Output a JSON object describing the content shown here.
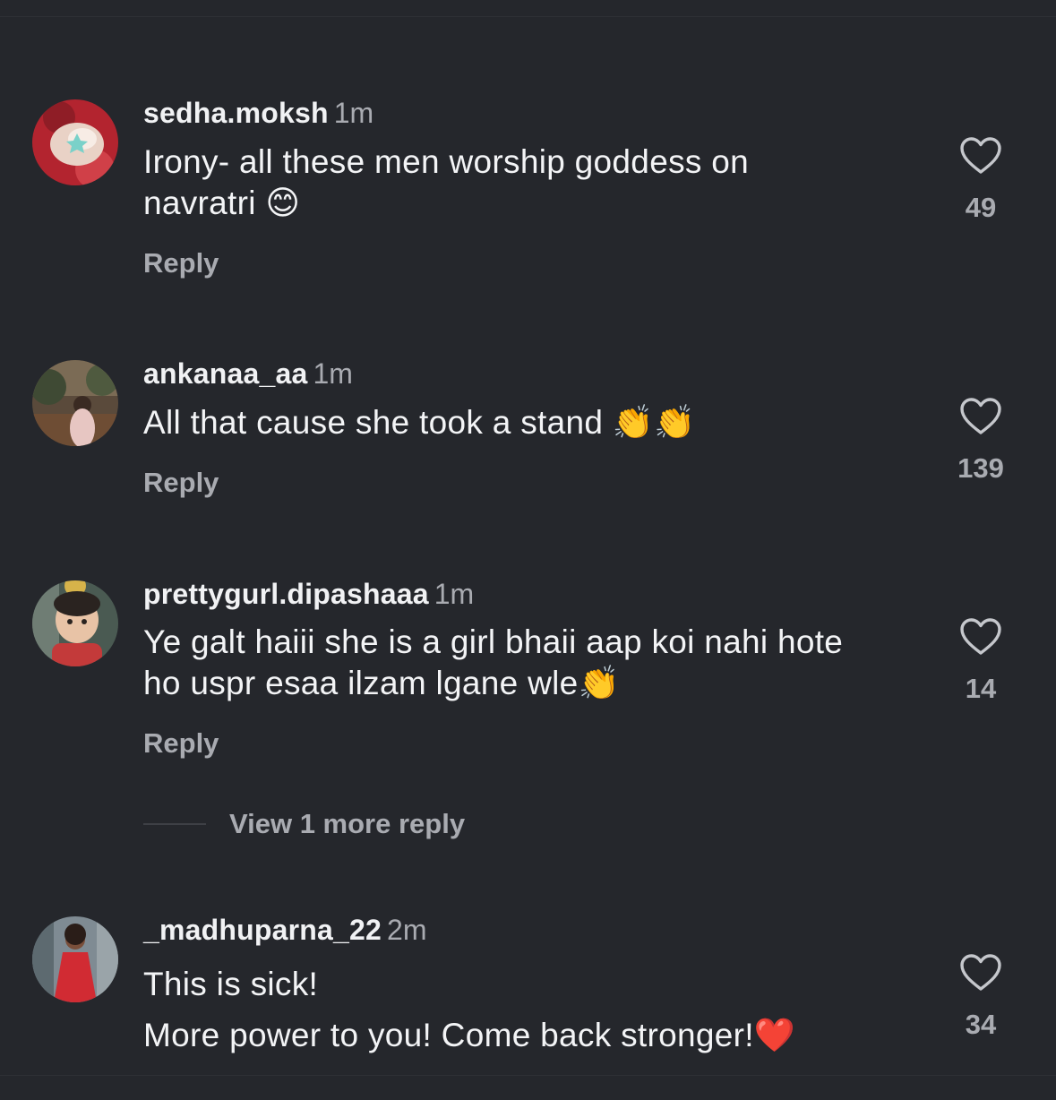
{
  "comments": [
    {
      "username": "sedha.moksh",
      "time": "1m",
      "lines": [
        "Irony- all these men worship goddess on",
        "navratri 😊"
      ],
      "reply_label": "Reply",
      "likes": "49",
      "avatar_icon": "avatar-photo-icon"
    },
    {
      "username": "ankanaa_aa",
      "time": "1m",
      "lines": [
        "All that cause she took a stand 👏👏"
      ],
      "reply_label": "Reply",
      "likes": "139",
      "avatar_icon": "avatar-photo-icon"
    },
    {
      "username": "prettygurl.dipashaaa",
      "time": "1m",
      "lines": [
        "Ye galt haiii she is a girl bhaii aap koi nahi hote",
        "ho uspr esaa ilzam lgane wle👏"
      ],
      "reply_label": "Reply",
      "likes": "14",
      "avatar_icon": "avatar-photo-icon"
    },
    {
      "username": "_madhuparna_22",
      "time": "2m",
      "lines": [
        "This is sick!",
        "More power to you! Come back stronger!❤️"
      ],
      "likes": "34",
      "avatar_icon": "avatar-photo-icon"
    }
  ],
  "view_more_replies": "View 1 more reply",
  "icons": {
    "like": "heart-outline-icon"
  },
  "colors": {
    "background": "#25272c",
    "primary_text": "#f1f2f4",
    "secondary_text": "#a9abb1"
  }
}
